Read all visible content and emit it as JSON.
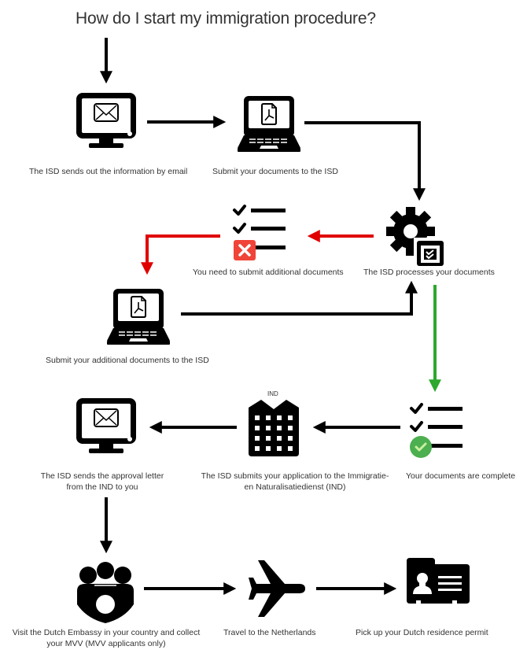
{
  "title": "How do I start my immigration procedure?",
  "colors": {
    "line": "#000000",
    "reject": "#e00000",
    "approve": "#2ea82e",
    "reject_badge": "#f04438",
    "approve_badge": "#4caf50",
    "approve_check": "#c8f0a0"
  },
  "steps": [
    {
      "id": "email-info",
      "icon": "monitor-email-icon",
      "label": "The ISD sends out the information by email"
    },
    {
      "id": "submit-docs",
      "icon": "laptop-pdf-icon",
      "label": "Submit your documents to the ISD"
    },
    {
      "id": "isd-processes",
      "icon": "gear-checklist-icon",
      "label": "The ISD processes your documents"
    },
    {
      "id": "additional-needed",
      "icon": "checklist-rejected-icon",
      "label": "You need to submit additional documents"
    },
    {
      "id": "submit-additional",
      "icon": "laptop-pdf-icon",
      "label": "Submit your additional documents to the ISD"
    },
    {
      "id": "docs-complete",
      "icon": "checklist-approved-icon",
      "label": "Your documents are complete"
    },
    {
      "id": "submit-to-ind",
      "icon": "building-icon",
      "badge": "IND",
      "label_lines": [
        "The ISD submits your application to the Immigratie-",
        "en Naturalisatiedienst (IND)"
      ]
    },
    {
      "id": "approval-letter",
      "icon": "monitor-email-icon",
      "label_lines": [
        "The ISD sends the approval letter",
        "from the IND to you"
      ]
    },
    {
      "id": "visit-embassy",
      "icon": "group-people-icon",
      "label_lines": [
        "Visit the Dutch Embassy in your country and collect",
        "your MVV (MVV applicants only)"
      ]
    },
    {
      "id": "travel",
      "icon": "airplane-icon",
      "label": "Travel to the Netherlands"
    },
    {
      "id": "pickup-permit",
      "icon": "id-card-icon",
      "label": "Pick up your Dutch residence permit"
    }
  ]
}
